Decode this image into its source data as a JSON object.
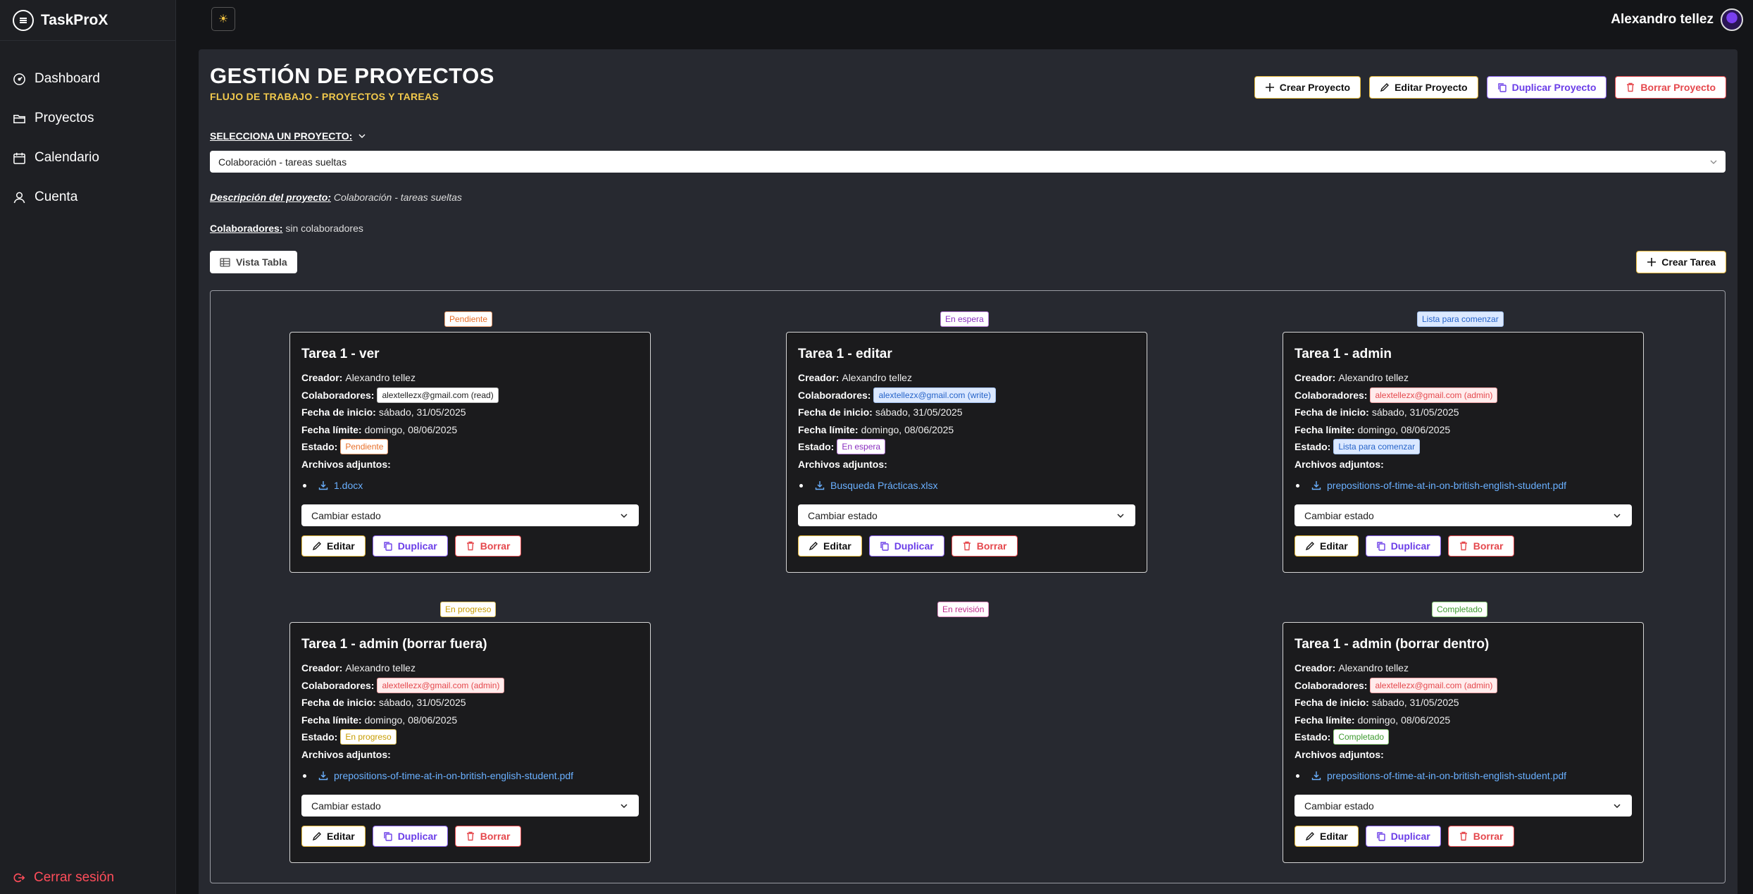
{
  "app": {
    "name": "TaskProX"
  },
  "sidebar": {
    "items": [
      {
        "label": "Dashboard",
        "icon": "gauge-icon"
      },
      {
        "label": "Proyectos",
        "icon": "folder-icon"
      },
      {
        "label": "Calendario",
        "icon": "calendar-icon"
      },
      {
        "label": "Cuenta",
        "icon": "user-icon"
      }
    ],
    "logout_label": "Cerrar sesión"
  },
  "topbar": {
    "theme_icon": "☀",
    "user_name": "Alexandro tellez"
  },
  "page": {
    "title": "GESTIÓN DE PROYECTOS",
    "subtitle": "FLUJO DE TRABAJO - PROYECTOS Y TAREAS",
    "actions": {
      "create": "Crear Proyecto",
      "edit": "Editar Proyecto",
      "duplicate": "Duplicar Proyecto",
      "delete": "Borrar Proyecto"
    },
    "select_label": "SELECCIONA UN PROYECTO:",
    "selected_project": "Colaboración - tareas sueltas",
    "description_label": "Descripción del proyecto:",
    "description": "Colaboración - tareas sueltas",
    "collaborators_label": "Colaboradores:",
    "collaborators": "sin colaboradores",
    "view_table_label": "Vista Tabla",
    "create_task_label": "Crear Tarea"
  },
  "labels": {
    "creator": "Creador:",
    "collaborators": "Colaboradores:",
    "start": "Fecha de inicio:",
    "due": "Fecha límite:",
    "state": "Estado:",
    "attachments": "Archivos adjuntos:",
    "change_state": "Cambiar estado",
    "edit": "Editar",
    "duplicate": "Duplicar",
    "delete": "Borrar"
  },
  "columns": [
    {
      "status": "Pendiente"
    },
    {
      "status": "En espera"
    },
    {
      "status": "Lista para comenzar"
    },
    {
      "status": "En progreso"
    },
    {
      "status": "En revisión"
    },
    {
      "status": "Completado"
    }
  ],
  "tasks": [
    {
      "title": "Tarea 1 - ver",
      "creator": "Alexandro tellez",
      "collaborator": "alextellezx@gmail.com (read)",
      "start": "sábado, 31/05/2025",
      "due": "domingo, 08/06/2025",
      "state": "Pendiente",
      "attachment": "1.docx"
    },
    {
      "title": "Tarea 1 - editar",
      "creator": "Alexandro tellez",
      "collaborator": "alextellezx@gmail.com (write)",
      "start": "sábado, 31/05/2025",
      "due": "domingo, 08/06/2025",
      "state": "En espera",
      "attachment": "Busqueda Prácticas.xlsx"
    },
    {
      "title": "Tarea 1 - admin",
      "creator": "Alexandro tellez",
      "collaborator": "alextellezx@gmail.com (admin)",
      "start": "sábado, 31/05/2025",
      "due": "domingo, 08/06/2025",
      "state": "Lista para comenzar",
      "attachment": "prepositions-of-time-at-in-on-british-english-student.pdf"
    },
    {
      "title": "Tarea 1 - admin (borrar fuera)",
      "creator": "Alexandro tellez",
      "collaborator": "alextellezx@gmail.com (admin)",
      "start": "sábado, 31/05/2025",
      "due": "domingo, 08/06/2025",
      "state": "En progreso",
      "attachment": "prepositions-of-time-at-in-on-british-english-student.pdf"
    },
    {
      "title": "Tarea 1 - admin (borrar dentro)",
      "creator": "Alexandro tellez",
      "collaborator": "alextellezx@gmail.com (admin)",
      "start": "sábado, 31/05/2025",
      "due": "domingo, 08/06/2025",
      "state": "Completado",
      "attachment": "prepositions-of-time-at-in-on-british-english-student.pdf"
    }
  ]
}
